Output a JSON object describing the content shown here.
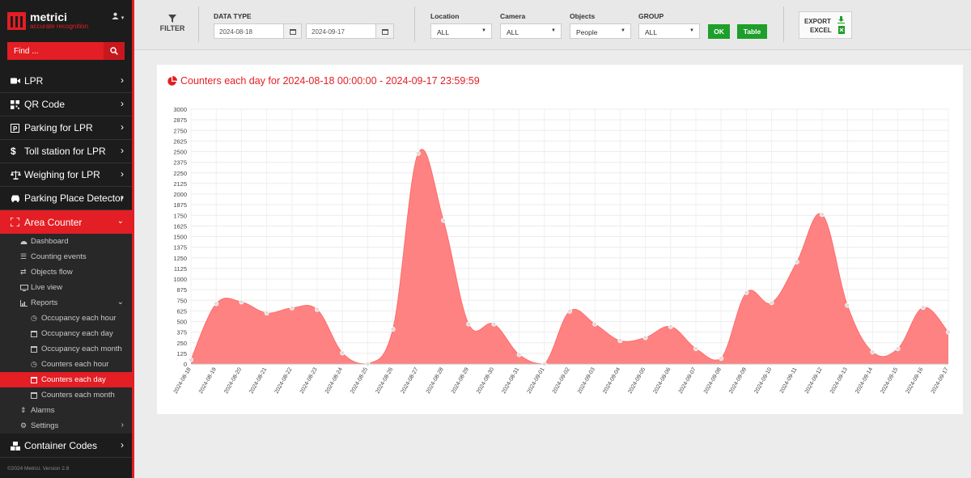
{
  "brand": {
    "name": "metrici",
    "tagline": "accurate recognition"
  },
  "search": {
    "placeholder": "Find ..."
  },
  "nav": [
    {
      "label": "LPR",
      "icon": "video-icon"
    },
    {
      "label": "QR Code",
      "icon": "qrcode-icon"
    },
    {
      "label": "Parking for LPR",
      "icon": "parking-icon"
    },
    {
      "label": "Toll station for LPR",
      "icon": "dollar-icon"
    },
    {
      "label": "Weighing for LPR",
      "icon": "scale-icon"
    },
    {
      "label": "Parking Place Detector",
      "icon": "car-icon"
    },
    {
      "label": "Area Counter",
      "icon": "expand-icon",
      "active": true
    },
    {
      "label": "Container Codes",
      "icon": "boxes-icon"
    }
  ],
  "area_counter_menu": [
    {
      "label": "Dashboard",
      "icon": "dashboard-icon"
    },
    {
      "label": "Counting events",
      "icon": "list-icon"
    },
    {
      "label": "Objects flow",
      "icon": "flow-icon"
    },
    {
      "label": "Live view",
      "icon": "monitor-icon"
    },
    {
      "label": "Reports",
      "icon": "chart-icon"
    }
  ],
  "reports_menu": [
    {
      "label": "Occupancy each hour",
      "icon": "clock-icon"
    },
    {
      "label": "Occupancy each day",
      "icon": "calendar-icon"
    },
    {
      "label": "Occupancy each month",
      "icon": "calendar-icon"
    },
    {
      "label": "Counters each hour",
      "icon": "clock-icon"
    },
    {
      "label": "Counters each day",
      "icon": "calendar-icon",
      "selected": true
    },
    {
      "label": "Counters each month",
      "icon": "calendar-icon"
    }
  ],
  "extra_menu": [
    {
      "label": "Alarms",
      "icon": "arrows-icon"
    },
    {
      "label": "Settings",
      "icon": "gear-icon"
    }
  ],
  "footer": "©2024 Metrici. Version 2.8",
  "filter": {
    "label": "FILTER",
    "data_type_label": "DATA TYPE",
    "date_from": "2024-08-18",
    "date_to": "2024-09-17",
    "location_label": "Location",
    "location_value": "ALL",
    "camera_label": "Camera",
    "camera_value": "ALL",
    "objects_label": "Objects",
    "objects_value": "People",
    "group_label": "GROUP",
    "group_value": "ALL",
    "ok_label": "OK",
    "table_label": "Table"
  },
  "export": {
    "line1": "EXPORT",
    "line2": "EXCEL"
  },
  "colors": {
    "accent": "#e31e24",
    "area": "#ff7b7b",
    "green": "#1e9e2a"
  },
  "chart_data": {
    "type": "area",
    "title": "Counters each day for 2024-08-18 00:00:00 - 2024-09-17 23:59:59",
    "ylim": [
      0,
      3000
    ],
    "yticks": [
      0,
      125,
      250,
      375,
      500,
      625,
      750,
      875,
      1000,
      1125,
      1250,
      1375,
      1500,
      1625,
      1750,
      1875,
      2000,
      2125,
      2250,
      2375,
      2500,
      2625,
      2750,
      2875,
      3000
    ],
    "categories": [
      "2024-08-18",
      "2024-08-19",
      "2024-08-20",
      "2024-08-21",
      "2024-08-22",
      "2024-08-23",
      "2024-08-24",
      "2024-08-25",
      "2024-08-26",
      "2024-08-27",
      "2024-08-28",
      "2024-08-29",
      "2024-08-30",
      "2024-08-31",
      "2024-09-01",
      "2024-09-02",
      "2024-09-03",
      "2024-09-04",
      "2024-09-05",
      "2024-09-06",
      "2024-09-07",
      "2024-09-08",
      "2024-09-09",
      "2024-09-10",
      "2024-09-11",
      "2024-09-12",
      "2024-09-13",
      "2024-09-14",
      "2024-09-15",
      "2024-09-16",
      "2024-09-17"
    ],
    "values": [
      50,
      710,
      730,
      600,
      660,
      640,
      130,
      0,
      410,
      2480,
      1690,
      470,
      470,
      110,
      0,
      620,
      470,
      275,
      310,
      440,
      180,
      65,
      840,
      720,
      1200,
      1760,
      690,
      140,
      180,
      665,
      375
    ],
    "grid": true,
    "legend": "none"
  }
}
